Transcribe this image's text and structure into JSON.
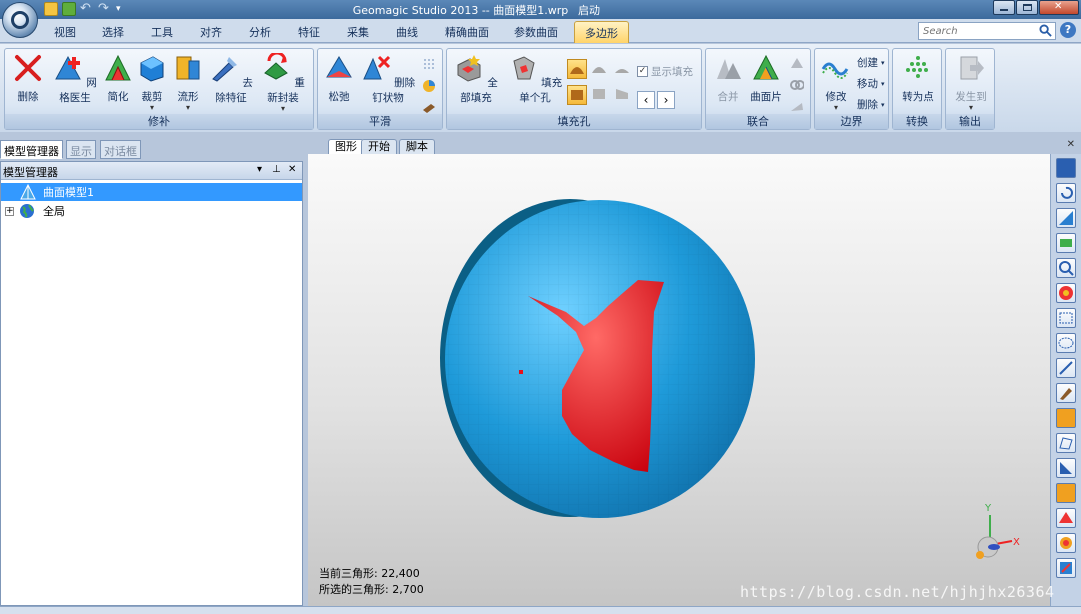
{
  "titlebar": {
    "title": "Geomagic Studio 2013 -- 曲面模型1.wrp",
    "launch": "启动"
  },
  "tabs": [
    {
      "label": "视图"
    },
    {
      "label": "选择"
    },
    {
      "label": "工具"
    },
    {
      "label": "对齐"
    },
    {
      "label": "分析"
    },
    {
      "label": "特征"
    },
    {
      "label": "采集"
    },
    {
      "label": "曲线"
    },
    {
      "label": "精确曲面"
    },
    {
      "label": "参数曲面"
    },
    {
      "label": "多边形"
    }
  ],
  "search": {
    "placeholder": "Search"
  },
  "ribbon": {
    "groups": {
      "repair": "修补",
      "smooth": "平滑",
      "fill": "填充孔",
      "merge": "联合",
      "boundary": "边界",
      "convert": "转换",
      "output": "输出"
    },
    "buttons": {
      "delete": "删除",
      "mesh_doctor": "网格医生",
      "simplify": "简化",
      "trim": "裁剪",
      "flow": "流形",
      "remove_feature": "去除特征",
      "rewrap": "重新封装",
      "relax": "松弛",
      "remove_spikes": "删除钉状物",
      "fill_all": "全部填充",
      "fill_single": "填充单个孔",
      "show_fill": "显示填充",
      "merge": "合并",
      "patch": "曲面片",
      "modify": "修改",
      "create": "创建",
      "move": "移动",
      "remove": "删除",
      "to_points": "转为点",
      "send_to": "发生到"
    }
  },
  "view_tabs": [
    {
      "label": "图形"
    },
    {
      "label": "开始"
    },
    {
      "label": "脚本"
    }
  ],
  "panel_tabs": [
    {
      "label": "模型管理器"
    },
    {
      "label": "显示"
    },
    {
      "label": "对话框"
    }
  ],
  "panel": {
    "header": "模型管理器",
    "tree": [
      {
        "label": "曲面模型1"
      },
      {
        "label": "全局"
      }
    ]
  },
  "viewport": {
    "current_triangles": "当前三角形: 22,400",
    "selected_triangles": "所选的三角形: 2,700",
    "axis_y": "Y",
    "axis_x": "X"
  },
  "watermark": "https://blog.csdn.net/hjhjhx26364",
  "colors": {
    "mesh": "#1f9ad6",
    "selection": "#e8101a",
    "accent": "#ffd46a"
  }
}
